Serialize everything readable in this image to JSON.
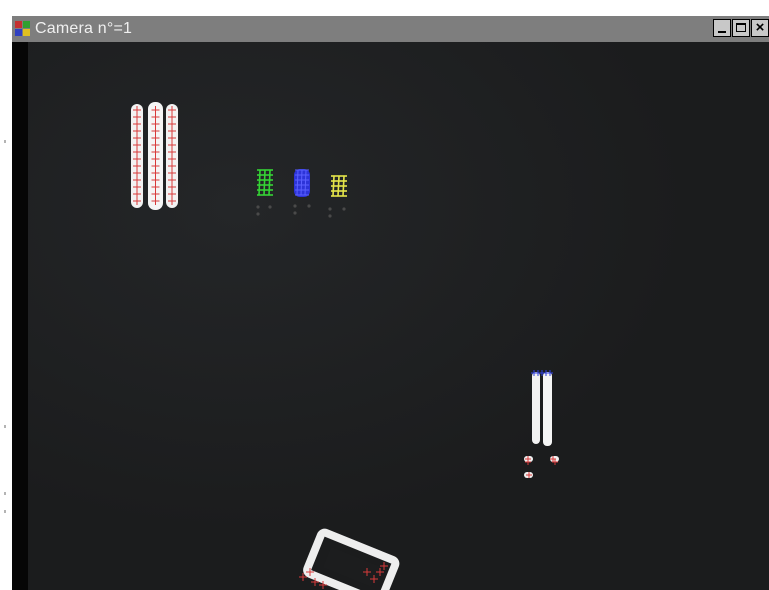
{
  "window": {
    "title": "Camera n°=1",
    "app_icon": "camera-app-icon",
    "controls": {
      "minimize_icon": "minimize-icon",
      "maximize_icon": "maximize-icon",
      "close_icon": "close-icon",
      "close_glyph": "×"
    }
  },
  "camera_view": {
    "colors": {
      "background": "#1c1d1e",
      "marker_bright": "#f4f4f4",
      "cross_red": "#d83a3a",
      "cross_green": "#35d435",
      "cross_blue": "#3438e8",
      "cross_yellow": "#e6e64a"
    }
  }
}
